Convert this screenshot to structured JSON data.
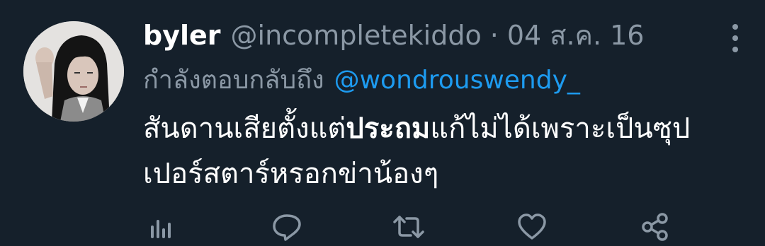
{
  "tweet": {
    "display_name": "byler",
    "handle": "@incompletekiddo",
    "separator": "·",
    "date": "04 ส.ค. 16",
    "reply_prefix": "กำลังตอบกลับถึง",
    "reply_mention": "@wondrouswendy_",
    "text_part1": "สันดานเสียตั้งแต่",
    "text_bold": "ประถม",
    "text_part2": "แก้ไม่ได้เพราะเป็นซุปเปอร์สตาร์หรอกข่าน้องๆ"
  },
  "icons": {
    "more": "more-vertical-icon",
    "analytics": "analytics-icon",
    "reply": "reply-icon",
    "retweet": "retweet-icon",
    "like": "heart-icon",
    "share": "share-icon"
  },
  "colors": {
    "background": "#15202b",
    "text": "#ffffff",
    "secondary": "#8b98a5",
    "link": "#1d9bf0"
  }
}
